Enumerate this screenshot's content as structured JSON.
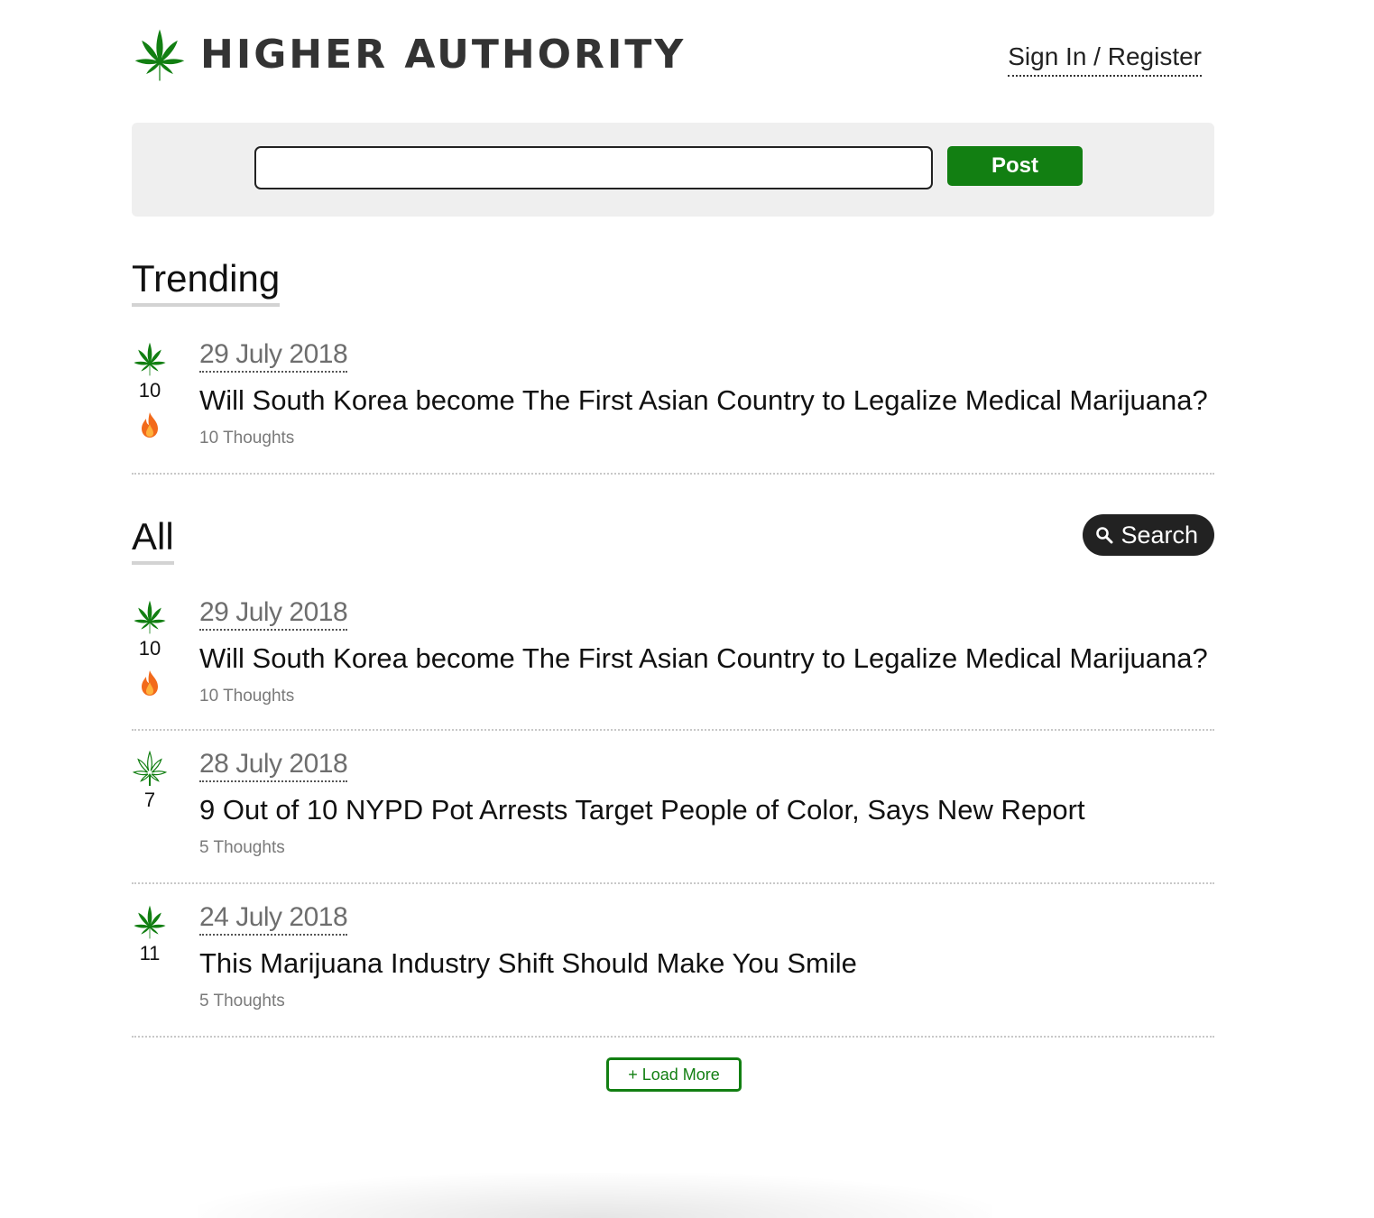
{
  "brand": {
    "name": "HIGHER AUTHORITY",
    "logo_icon": "cannabis-leaf-icon",
    "accent_color": "#127f12"
  },
  "header": {
    "auth_link": "Sign In / Register"
  },
  "post_bar": {
    "input_value": "",
    "post_label": "Post"
  },
  "trending": {
    "title": "Trending",
    "posts": [
      {
        "date": "29 July 2018",
        "title": "Will South Korea become The First Asian Country to Legalize Medical Marijuana?",
        "thoughts": "10 Thoughts",
        "votes": "10",
        "voted": true,
        "hot": true
      }
    ]
  },
  "all": {
    "title": "All",
    "search_label": "Search",
    "posts": [
      {
        "date": "29 July 2018",
        "title": "Will South Korea become The First Asian Country to Legalize Medical Marijuana?",
        "thoughts": "10 Thoughts",
        "votes": "10",
        "voted": true,
        "hot": true
      },
      {
        "date": "28 July 2018",
        "title": "9 Out of 10 NYPD Pot Arrests Target People of Color, Says New Report",
        "thoughts": "5 Thoughts",
        "votes": "7",
        "voted": false,
        "hot": false
      },
      {
        "date": "24 July 2018",
        "title": "This Marijuana Industry Shift Should Make You Smile",
        "thoughts": "5 Thoughts",
        "votes": "11",
        "voted": true,
        "hot": false
      }
    ],
    "load_more_label": "+ Load More"
  }
}
